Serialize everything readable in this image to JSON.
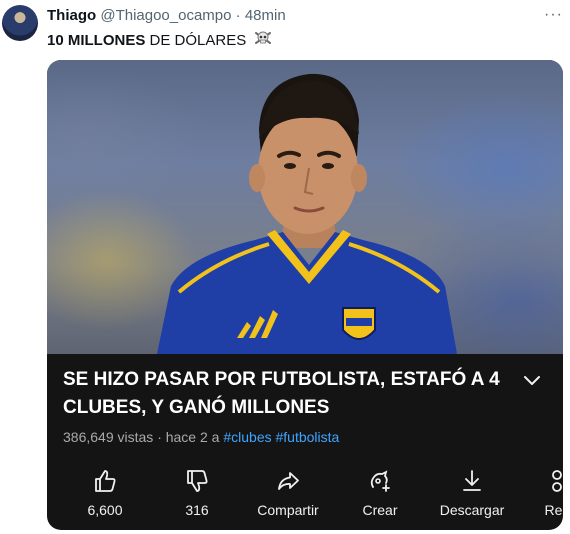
{
  "tweet": {
    "display_name": "Thiago",
    "handle": "@Thiagoo_ocampo",
    "separator": "·",
    "time": "48min",
    "more": "···",
    "text_bold": "10 MILLONES",
    "text_rest": " DE DÓLARES"
  },
  "video": {
    "title": "SE HIZO PASAR POR FUTBOLISTA, ESTAFÓ A 4 CLUBES, Y GANÓ MILLONES",
    "views": "386,649 vistas",
    "age": "· hace 2 a",
    "tags": [
      "#clubes",
      "#futbolista"
    ],
    "actions": [
      {
        "label": "6,600",
        "icon": "thumbs-up-icon"
      },
      {
        "label": "316",
        "icon": "thumbs-down-icon"
      },
      {
        "label": "Compartir",
        "icon": "share-icon"
      },
      {
        "label": "Crear",
        "icon": "create-icon"
      },
      {
        "label": "Descargar",
        "icon": "download-icon"
      },
      {
        "label": "Rec",
        "icon": "remix-icon"
      }
    ]
  },
  "colors": {
    "tag_blue": "#3ea6ff",
    "jersey_blue": "#1f3fa6",
    "jersey_yellow": "#f2c21b"
  }
}
